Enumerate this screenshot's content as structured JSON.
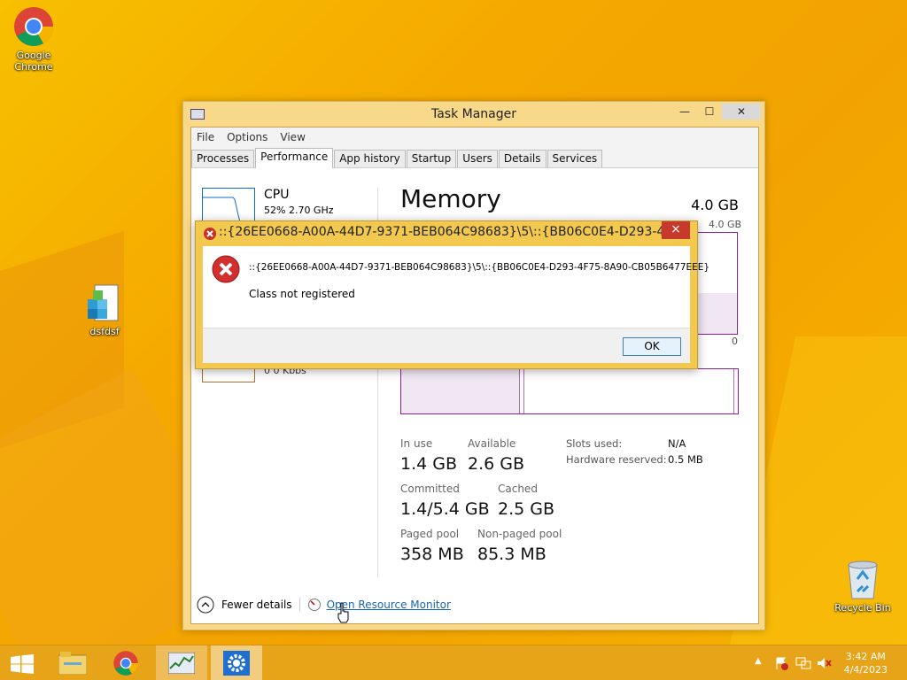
{
  "desktop": {
    "icons": [
      {
        "label": "Google Chrome",
        "icon": "chrome-icon"
      },
      {
        "label": "dsfdsf",
        "icon": "registry-file-icon"
      },
      {
        "label": "Recycle Bin",
        "icon": "recycle-bin-icon"
      }
    ]
  },
  "task_manager": {
    "title": "Task Manager",
    "menu": [
      "File",
      "Options",
      "View"
    ],
    "tabs": [
      "Processes",
      "Performance",
      "App history",
      "Startup",
      "Users",
      "Details",
      "Services"
    ],
    "active_tab": "Performance",
    "cpu": {
      "label": "CPU",
      "detail": "52%  2.70 GHz"
    },
    "left_partial_text": "0  0 Kbps",
    "memory": {
      "title": "Memory",
      "total": "4.0 GB",
      "graph_max": "4.0 GB",
      "graph_min": "0",
      "in_use_label": "In use",
      "in_use": "1.4 GB",
      "available_label": "Available",
      "available": "2.6 GB",
      "committed_label": "Committed",
      "committed": "1.4/5.4 GB",
      "cached_label": "Cached",
      "cached": "2.5 GB",
      "paged_label": "Paged pool",
      "paged": "358 MB",
      "nonpaged_label": "Non-paged pool",
      "nonpaged": "85.3 MB",
      "slots_label": "Slots used:",
      "slots": "N/A",
      "hw_label": "Hardware reserved:",
      "hw": "0.5 MB"
    },
    "footer": {
      "fewer": "Fewer details",
      "resmon": "Open Resource Monitor"
    }
  },
  "error_dialog": {
    "title": "::{26EE0668-A00A-44D7-9371-BEB064C98683}\\5\\::{BB06C0E4-D293-4F75-...",
    "path": "::{26EE0668-A00A-44D7-9371-BEB064C98683}\\5\\::{BB06C0E4-D293-4F75-8A90-CB05B6477EEE}",
    "message": "Class not registered",
    "ok_label": "OK",
    "close_glyph": "×"
  },
  "taskbar": {
    "items": [
      "start",
      "file-explorer",
      "chrome",
      "task-manager",
      "control-panel"
    ],
    "time": "3:42 AM",
    "date": "4/4/2023"
  }
}
